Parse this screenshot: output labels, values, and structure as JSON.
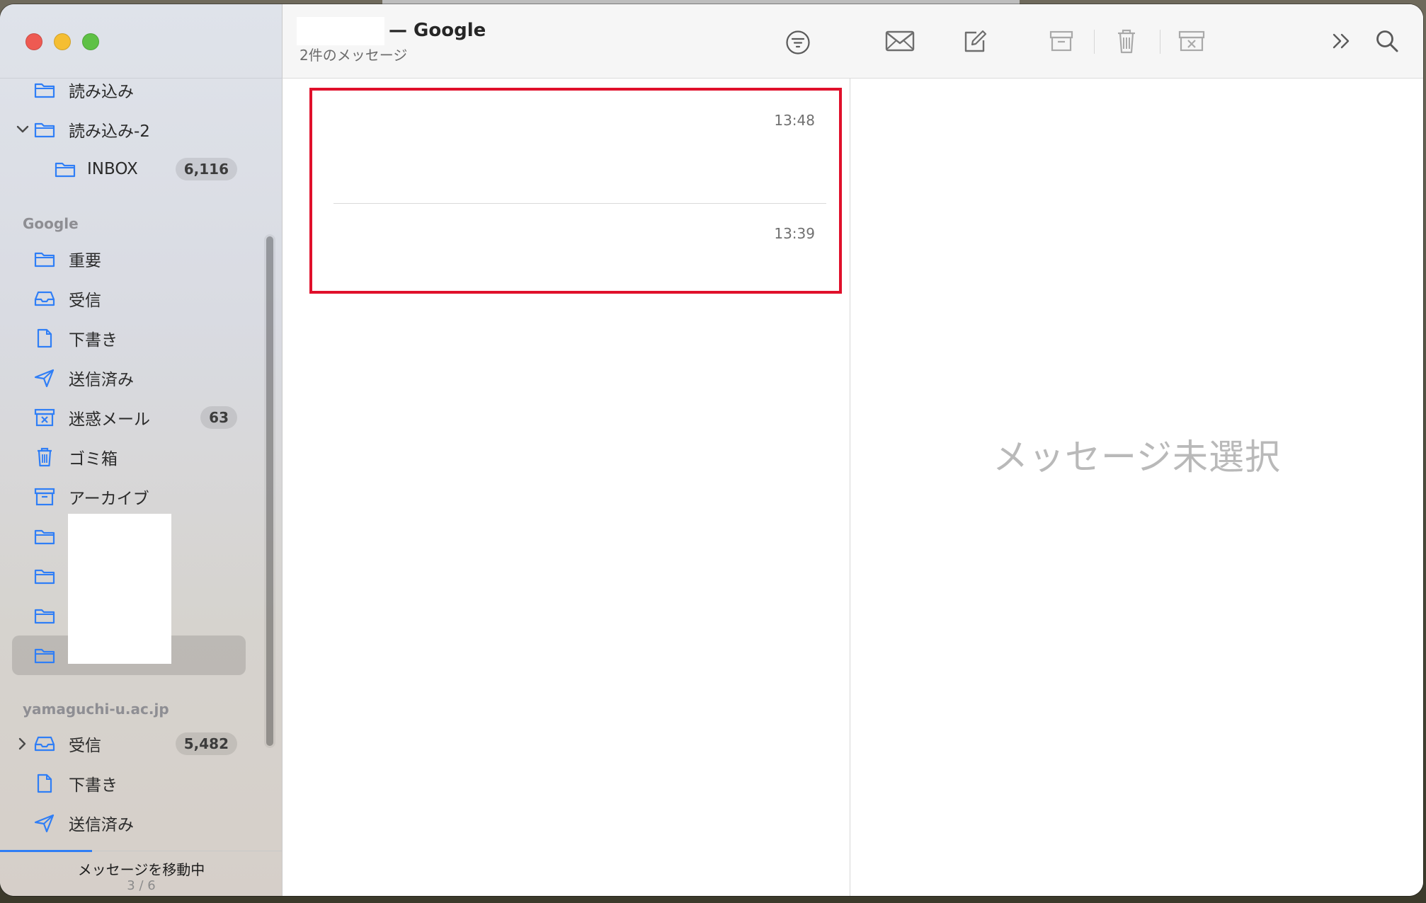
{
  "window": {
    "controls": [
      "close",
      "minimize",
      "zoom"
    ]
  },
  "sidebar": {
    "top_items": [
      {
        "label": "読み込み",
        "icon": "folder-icon"
      },
      {
        "label": "読み込み-2",
        "icon": "folder-icon",
        "expanded": true
      },
      {
        "label": "INBOX",
        "icon": "folder-icon",
        "badge": "6,116"
      }
    ],
    "google_section": {
      "title": "Google",
      "items": [
        {
          "label": "重要",
          "icon": "folder-icon"
        },
        {
          "label": "受信",
          "icon": "inbox-tray-icon"
        },
        {
          "label": "下書き",
          "icon": "document-icon"
        },
        {
          "label": "送信済み",
          "icon": "paper-plane-icon"
        },
        {
          "label": "迷惑メール",
          "icon": "junk-box-icon",
          "badge": "63"
        },
        {
          "label": "ゴミ箱",
          "icon": "trash-icon"
        },
        {
          "label": "アーカイブ",
          "icon": "archive-box-icon"
        },
        {
          "label": "",
          "icon": "folder-icon"
        },
        {
          "label": "",
          "icon": "folder-icon"
        },
        {
          "label": "",
          "icon": "folder-icon"
        },
        {
          "label": "",
          "icon": "folder-icon",
          "selected": true
        }
      ]
    },
    "yamaguchi_section": {
      "title": "yamaguchi-u.ac.jp",
      "items": [
        {
          "label": "受信",
          "icon": "inbox-tray-icon",
          "badge": "5,482",
          "collapsed": true
        },
        {
          "label": "下書き",
          "icon": "document-icon"
        },
        {
          "label": "送信済み",
          "icon": "paper-plane-icon"
        }
      ]
    },
    "footer": {
      "status": "メッセージを移動中",
      "count": "3 / 6"
    }
  },
  "message_list": {
    "title": "— Google",
    "subtitle": "2件のメッセージ",
    "messages": [
      {
        "time": "13:48"
      },
      {
        "time": "13:39"
      }
    ]
  },
  "toolbar": {
    "buttons": [
      "envelope-icon",
      "compose-icon",
      "archive-icon",
      "trash-icon",
      "junk-icon",
      "more-chevron-icon",
      "search-icon"
    ]
  },
  "reader": {
    "empty_text": "メッセージ未選択"
  },
  "colors": {
    "accent": "#2f7ef6",
    "highlight_border": "#e0102b",
    "icon_blue": "#2f7ef6",
    "toolbar_icon": "#6e6e6e"
  }
}
